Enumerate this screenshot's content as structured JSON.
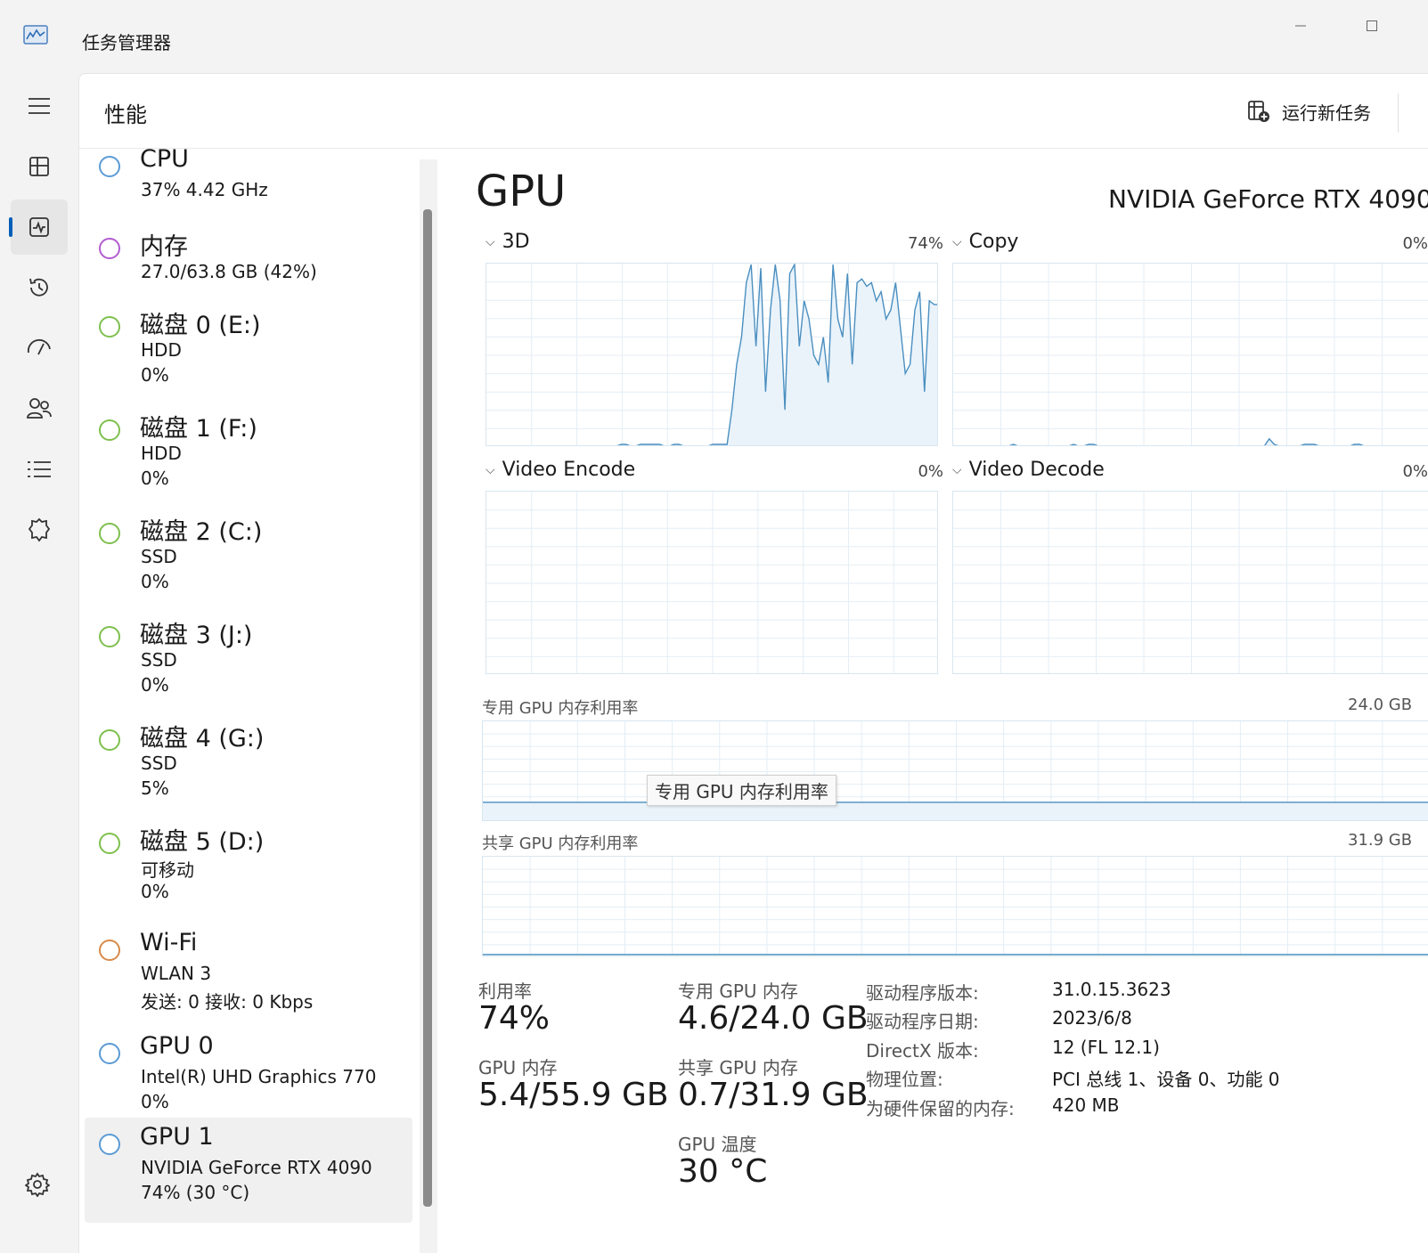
{
  "window": {
    "title": "任务管理器"
  },
  "colors": {
    "accent": "#005fb8",
    "graph_line": "#4a8fc0",
    "graph_fill": "#eaf3fa",
    "grid": "#e4eef5",
    "dot_blue": "#5b9bd5",
    "dot_purple": "#b35bd0",
    "dot_green": "#7ec04e",
    "dot_orange": "#d88a4a"
  },
  "nav": {
    "items": [
      {
        "name": "hamburger-menu-icon"
      },
      {
        "name": "processes-icon"
      },
      {
        "name": "performance-icon"
      },
      {
        "name": "app-history-icon"
      },
      {
        "name": "startup-apps-icon"
      },
      {
        "name": "users-icon"
      },
      {
        "name": "details-icon"
      },
      {
        "name": "services-icon"
      }
    ],
    "settings_icon": "settings-icon"
  },
  "header": {
    "page_title": "性能",
    "run_task_label": "运行新任务"
  },
  "resources": [
    {
      "name": "CPU",
      "lines": [
        "37%  4.42 GHz"
      ],
      "color": "dot_blue"
    },
    {
      "name": "内存",
      "lines": [
        "27.0/63.8 GB (42%)"
      ],
      "color": "dot_purple"
    },
    {
      "name": "磁盘 0 (E:)",
      "lines": [
        "HDD",
        "0%"
      ],
      "color": "dot_green"
    },
    {
      "name": "磁盘 1 (F:)",
      "lines": [
        "HDD",
        "0%"
      ],
      "color": "dot_green"
    },
    {
      "name": "磁盘 2 (C:)",
      "lines": [
        "SSD",
        "0%"
      ],
      "color": "dot_green"
    },
    {
      "name": "磁盘 3 (J:)",
      "lines": [
        "SSD",
        "0%"
      ],
      "color": "dot_green"
    },
    {
      "name": "磁盘 4 (G:)",
      "lines": [
        "SSD",
        "5%"
      ],
      "color": "dot_green"
    },
    {
      "name": "磁盘 5 (D:)",
      "lines": [
        "可移动",
        "0%"
      ],
      "color": "dot_green"
    },
    {
      "name": "Wi-Fi",
      "lines": [
        "WLAN 3",
        "发送: 0  接收: 0 Kbps"
      ],
      "color": "dot_orange"
    },
    {
      "name": "GPU 0",
      "lines": [
        "Intel(R) UHD Graphics 770",
        "0%"
      ],
      "color": "dot_blue"
    },
    {
      "name": "GPU 1",
      "lines": [
        "NVIDIA GeForce RTX 4090",
        "74%  (30 °C)"
      ],
      "color": "dot_blue"
    }
  ],
  "detail": {
    "title": "GPU",
    "model": "NVIDIA GeForce RTX 4090",
    "engines": [
      {
        "label": "3D",
        "percent": "74%"
      },
      {
        "label": "Copy",
        "percent": "0%"
      },
      {
        "label": "Video Encode",
        "percent": "0%"
      },
      {
        "label": "Video Decode",
        "percent": "0%"
      }
    ],
    "engine_3d_history": [
      0,
      0,
      0,
      0,
      0,
      0,
      0,
      0,
      0,
      0,
      0,
      0,
      0,
      0,
      0,
      0,
      0,
      0,
      0,
      0,
      0,
      0,
      0,
      0,
      0,
      0,
      0,
      0,
      1,
      1,
      0,
      0,
      1,
      1,
      1,
      1,
      1,
      0,
      0,
      1,
      1,
      0,
      0,
      0,
      0,
      0,
      0,
      1,
      1,
      1,
      1,
      20,
      45,
      60,
      90,
      100,
      55,
      98,
      30,
      75,
      100,
      80,
      20,
      95,
      100,
      55,
      80,
      70,
      50,
      45,
      60,
      35,
      100,
      70,
      60,
      95,
      45,
      90,
      92,
      88,
      90,
      80,
      85,
      70,
      75,
      90,
      65,
      40,
      45,
      75,
      85,
      30,
      80,
      78,
      78
    ],
    "copy_history": [
      0,
      0,
      0,
      0,
      0,
      0,
      0,
      0,
      0,
      0,
      0,
      0,
      1,
      0,
      0,
      0,
      0,
      0,
      0,
      0,
      0,
      0,
      0,
      0,
      1,
      0,
      0,
      1,
      1,
      0,
      0,
      0,
      0,
      0,
      0,
      0,
      0,
      0,
      0,
      0,
      0,
      0,
      0,
      0,
      0,
      0,
      0,
      0,
      0,
      0,
      0,
      0,
      0,
      0,
      0,
      0,
      0,
      0,
      0,
      0,
      0,
      0,
      0,
      4,
      1,
      0,
      0,
      0,
      0,
      0,
      1,
      1,
      1,
      0,
      0,
      0,
      0,
      0,
      0,
      0,
      1,
      1,
      0,
      0,
      0,
      0,
      0,
      0,
      0,
      0,
      0,
      0,
      0,
      0,
      0,
      0
    ],
    "dedicated_label": "专用 GPU 内存利用率",
    "dedicated_max": "24.0 GB",
    "dedicated_fraction": 0.19,
    "tooltip": "专用 GPU 内存利用率",
    "shared_label": "共享 GPU 内存利用率",
    "shared_max": "31.9 GB",
    "shared_fraction": 0.02,
    "stats": {
      "utilization_label": "利用率",
      "utilization_value": "74%",
      "gpu_mem_label": "GPU 内存",
      "gpu_mem_value": "5.4/55.9 GB",
      "dedicated_mem_label": "专用 GPU 内存",
      "dedicated_mem_value": "4.6/24.0 GB",
      "shared_mem_label": "共享 GPU 内存",
      "shared_mem_value": "0.7/31.9 GB",
      "temp_label": "GPU 温度",
      "temp_value": "30 °C"
    },
    "info": [
      {
        "key": "驱动程序版本:",
        "value": "31.0.15.3623"
      },
      {
        "key": "驱动程序日期:",
        "value": "2023/6/8"
      },
      {
        "key": "DirectX 版本:",
        "value": "12 (FL 12.1)"
      },
      {
        "key": "物理位置:",
        "value": "PCI 总线 1、设备 0、功能 0"
      },
      {
        "key": "为硬件保留的内存:",
        "value": "420 MB"
      }
    ]
  }
}
